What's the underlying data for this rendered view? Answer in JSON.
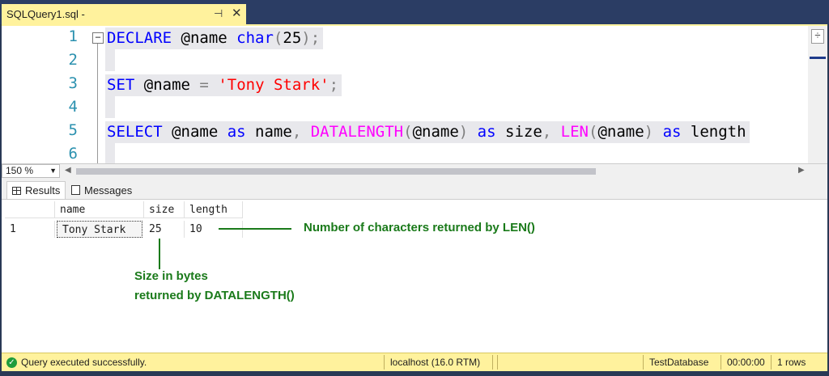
{
  "tab": {
    "title": "SQLQuery1.sql -",
    "pin": "⊣",
    "close": "✕"
  },
  "editor": {
    "line_numbers": [
      "1",
      "2",
      "3",
      "4",
      "5",
      "6"
    ],
    "lines": {
      "l1": {
        "kw1": "DECLARE",
        "t1": " @name ",
        "kw2": "char",
        "p1": "(",
        "n1": "25",
        "p2": ");"
      },
      "l3": {
        "kw1": "SET",
        "t1": " @name ",
        "eq": "=",
        "sp": " ",
        "str": "'Tony Stark'",
        "semi": ";"
      },
      "l5": {
        "kw1": "SELECT",
        "t1": " @name ",
        "kw2": "as",
        "t2": " name",
        "c1": ",",
        "sp1": " ",
        "fn1": "DATALENGTH",
        "p1": "(",
        "t3": "@name",
        "p2": ")",
        "sp2": " ",
        "kw3": "as",
        "t4": " size",
        "c2": ",",
        "sp3": " ",
        "fn2": "LEN",
        "p3": "(",
        "t5": "@name",
        "p4": ")",
        "sp4": " ",
        "kw4": "as",
        "t6": " length"
      }
    }
  },
  "zoom": {
    "value": "150 %"
  },
  "results_tabs": {
    "results": "Results",
    "messages": "Messages"
  },
  "grid": {
    "headers": [
      "name",
      "size",
      "length"
    ],
    "rows": [
      {
        "index": "1",
        "name": "Tony Stark",
        "size": "25",
        "length": "10"
      }
    ]
  },
  "annotations": {
    "len": "Number of characters returned by LEN()",
    "datalength_line1": "Size in bytes",
    "datalength_line2": "returned by DATALENGTH()"
  },
  "status": {
    "message": "Query executed successfully.",
    "server": "localhost (16.0 RTM)",
    "database": "TestDatabase",
    "time": "00:00:00",
    "rows": "1 rows"
  },
  "colors": {
    "tab_accent": "#fff29d",
    "keyword": "#0000ff",
    "function": "#ff00ff",
    "string": "#ff0000",
    "line_number": "#2b91af",
    "annotation": "#1a7a1a"
  }
}
